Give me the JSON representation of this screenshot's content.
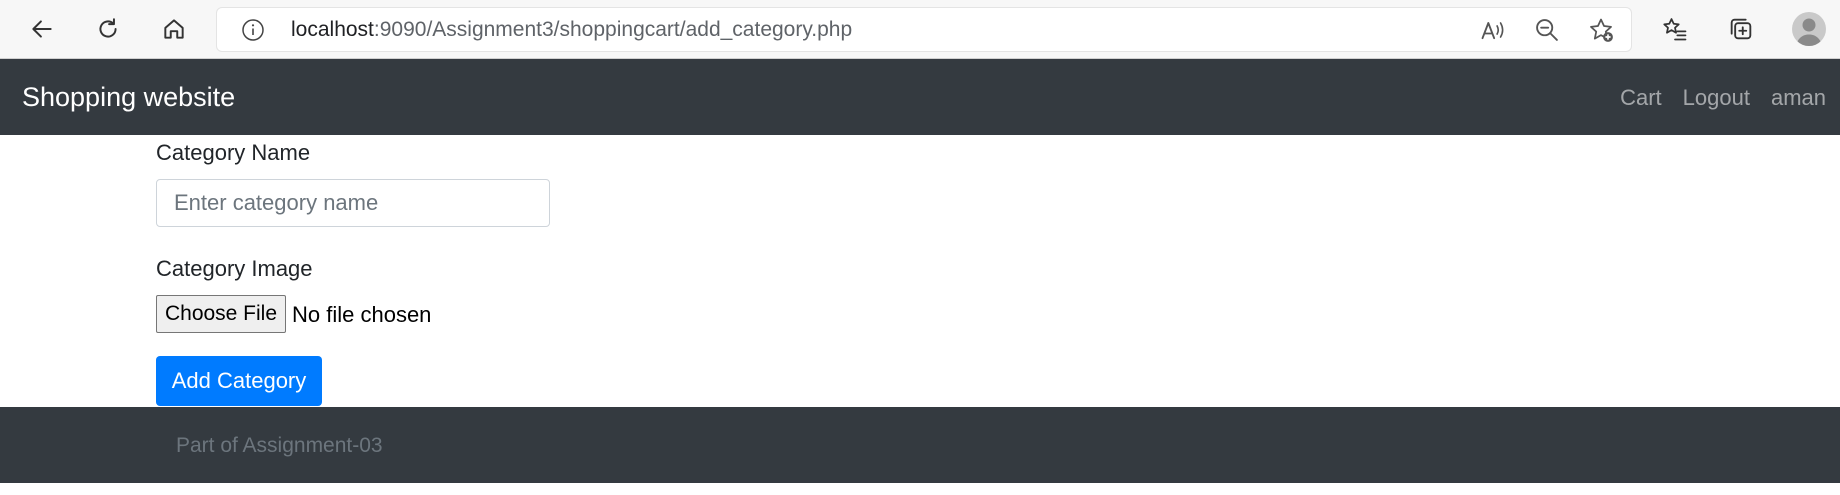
{
  "browser": {
    "url_host": "localhost",
    "url_rest": ":9090/Assignment3/shoppingcart/add_category.php"
  },
  "navbar": {
    "brand": "Shopping website",
    "links": [
      "Cart",
      "Logout",
      "aman"
    ]
  },
  "form": {
    "category_name_label": "Category Name",
    "category_name_placeholder": "Enter category name",
    "category_image_label": "Category Image",
    "choose_file_label": "Choose File",
    "no_file_text": "No file chosen",
    "submit_label": "Add Category"
  },
  "footer": {
    "text": "Part of Assignment-03"
  },
  "colors": {
    "navbar_bg": "#343a40",
    "primary": "#007bff"
  }
}
